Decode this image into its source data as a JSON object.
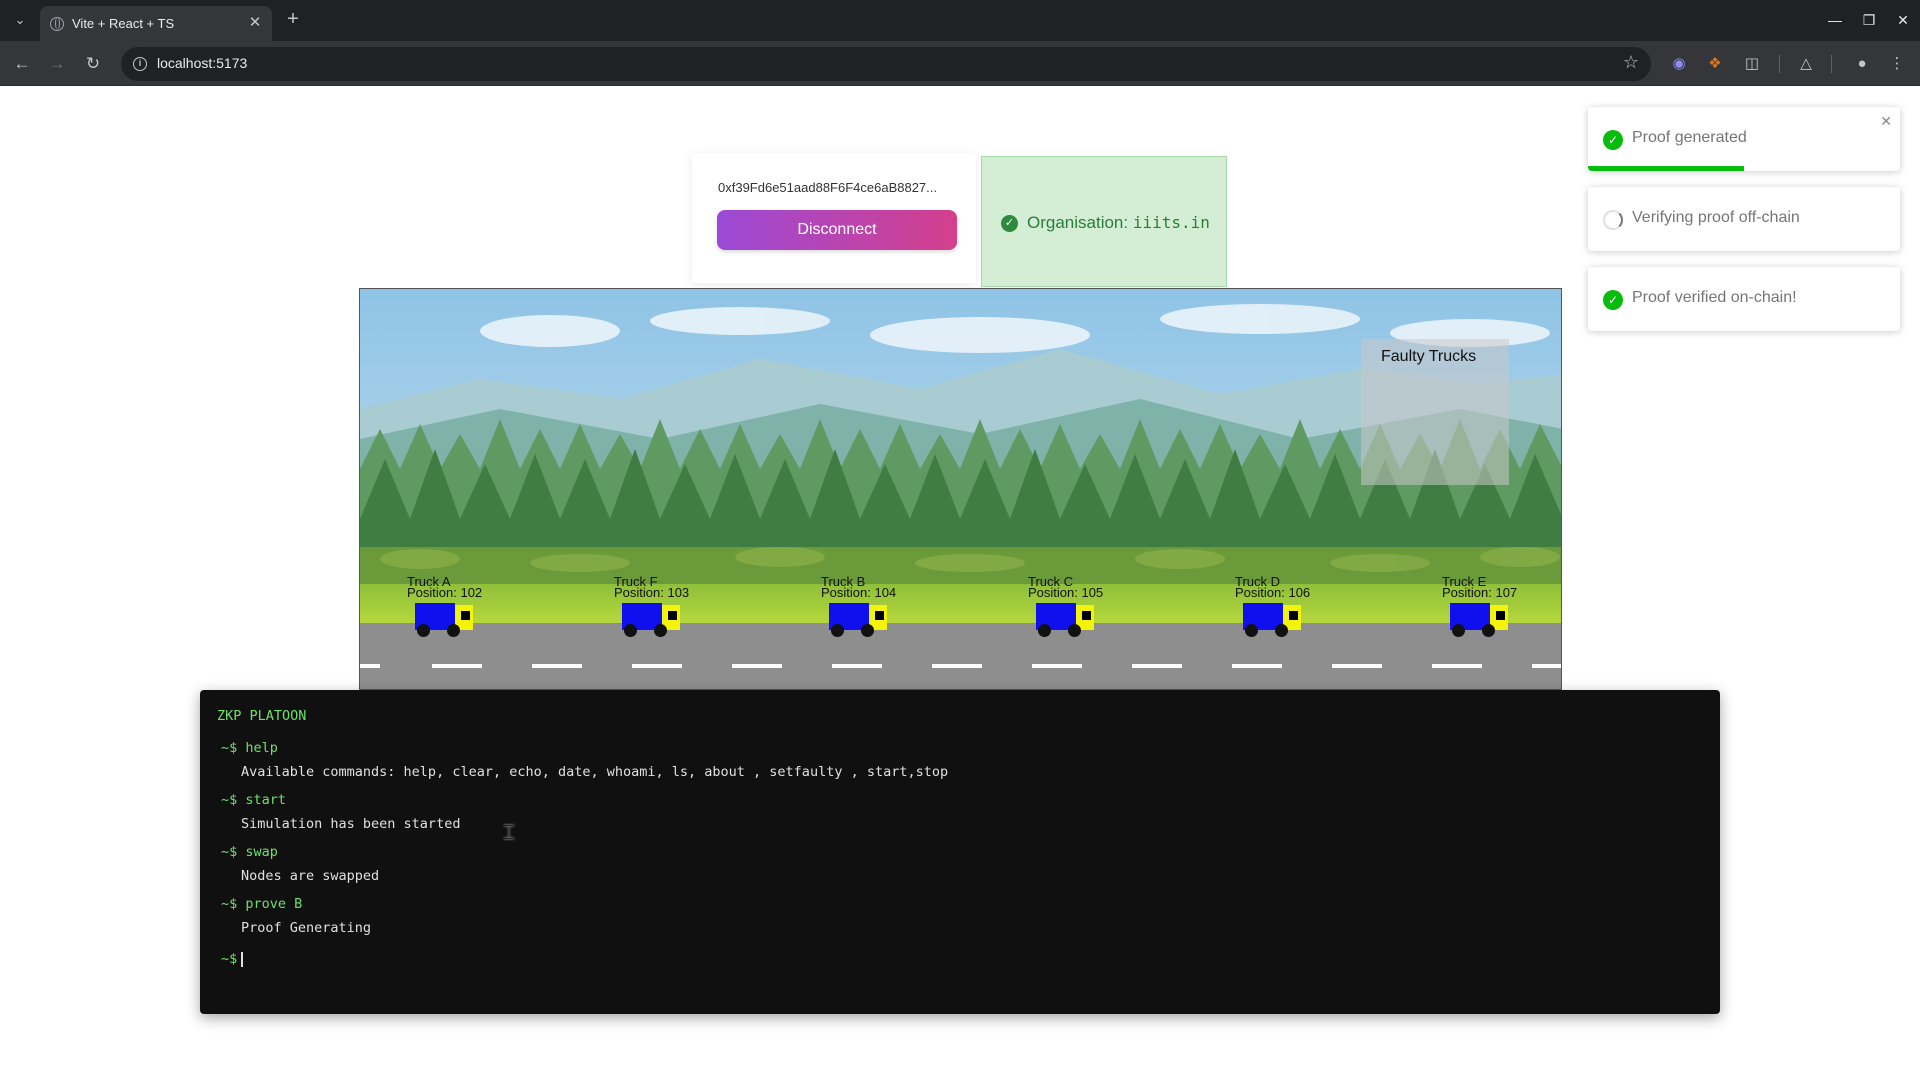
{
  "browser": {
    "tab_title": "Vite + React + TS",
    "url": "localhost:5173",
    "icons": [
      "tab-list-icon",
      "globe-icon",
      "close-icon",
      "plus-icon",
      "back-icon",
      "forward-icon",
      "reload-icon",
      "info-icon",
      "star-icon",
      "extension-icon",
      "profile-icon",
      "menu-icon"
    ]
  },
  "wallet": {
    "address": "0xf39Fd6e51aad88F6F4ce6aB8827...",
    "disconnect_label": "Disconnect"
  },
  "organisation": {
    "label": "Organisation: ",
    "value": "iiits.in",
    "status_color": "#2b7d39"
  },
  "scene": {
    "faulty_title": "Faulty Trucks",
    "trucks": [
      {
        "name": "Truck A",
        "position": "Position: 102"
      },
      {
        "name": "Truck F",
        "position": "Position: 103"
      },
      {
        "name": "Truck B",
        "position": "Position: 104"
      },
      {
        "name": "Truck C",
        "position": "Position: 105"
      },
      {
        "name": "Truck D",
        "position": "Position: 106"
      },
      {
        "name": "Truck E",
        "position": "Position: 107"
      }
    ]
  },
  "terminal": {
    "title": "ZKP PLATOON",
    "prompt": "~$",
    "entries": [
      {
        "command": "help",
        "output": "Available commands: help, clear, echo, date, whoami, ls, about , setfaulty , start,stop"
      },
      {
        "command": "start",
        "output": "Simulation has been started"
      },
      {
        "command": "swap",
        "output": "Nodes are swapped"
      },
      {
        "command": "prove B",
        "output": "Proof Generating"
      }
    ]
  },
  "toasts": [
    {
      "text": "Proof generated",
      "status": "success",
      "progress": 0.5
    },
    {
      "text": "Verifying proof off-chain",
      "status": "loading"
    },
    {
      "text": "Proof verified on-chain!",
      "status": "success"
    }
  ]
}
